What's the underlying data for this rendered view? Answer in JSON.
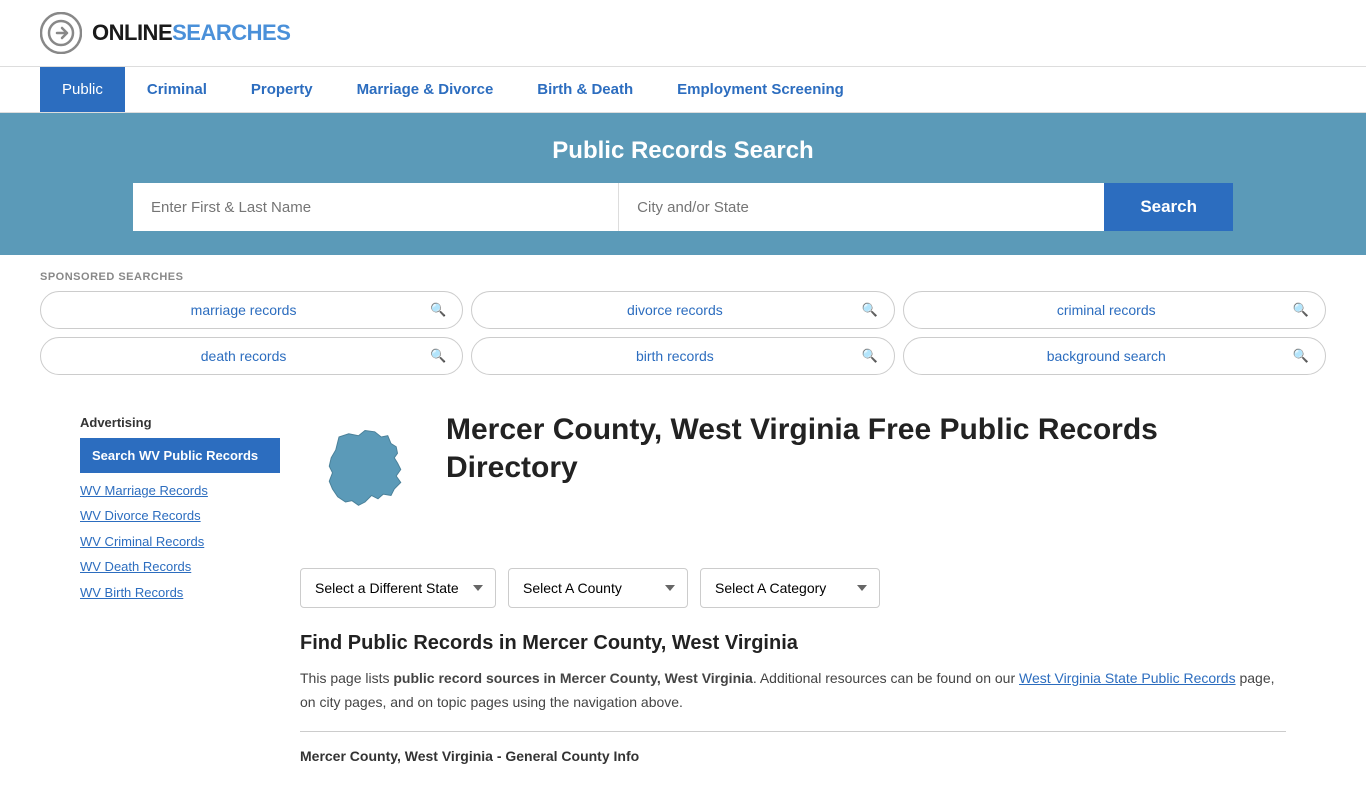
{
  "header": {
    "logo_online": "ONLINE",
    "logo_searches": "SEARCHES"
  },
  "nav": {
    "items": [
      {
        "label": "Public",
        "active": true
      },
      {
        "label": "Criminal",
        "active": false
      },
      {
        "label": "Property",
        "active": false
      },
      {
        "label": "Marriage & Divorce",
        "active": false
      },
      {
        "label": "Birth & Death",
        "active": false
      },
      {
        "label": "Employment Screening",
        "active": false
      }
    ]
  },
  "banner": {
    "title": "Public Records Search",
    "name_placeholder": "Enter First & Last Name",
    "location_placeholder": "City and/or State",
    "search_button": "Search"
  },
  "sponsored": {
    "label": "SPONSORED SEARCHES",
    "items": [
      {
        "text": "marriage records"
      },
      {
        "text": "divorce records"
      },
      {
        "text": "criminal records"
      },
      {
        "text": "death records"
      },
      {
        "text": "birth records"
      },
      {
        "text": "background search"
      }
    ]
  },
  "sidebar": {
    "ad_label": "Advertising",
    "featured_label": "Search WV Public Records",
    "links": [
      {
        "text": "WV Marriage Records"
      },
      {
        "text": "WV Divorce Records"
      },
      {
        "text": "WV Criminal Records"
      },
      {
        "text": "WV Death Records"
      },
      {
        "text": "WV Birth Records"
      }
    ]
  },
  "main": {
    "page_title": "Mercer County, West Virginia Free Public Records Directory",
    "dropdown_state": "Select a Different State",
    "dropdown_county": "Select A County",
    "dropdown_category": "Select A Category",
    "find_title": "Find Public Records in Mercer County, West Virginia",
    "find_text_1": "This page lists ",
    "find_text_bold": "public record sources in Mercer County, West Virginia",
    "find_text_2": ". Additional resources can be found on our ",
    "find_link_text": "West Virginia State Public Records",
    "find_text_3": " page, on city pages, and on topic pages using the navigation above.",
    "general_info_title": "Mercer County, West Virginia - General County Info"
  }
}
